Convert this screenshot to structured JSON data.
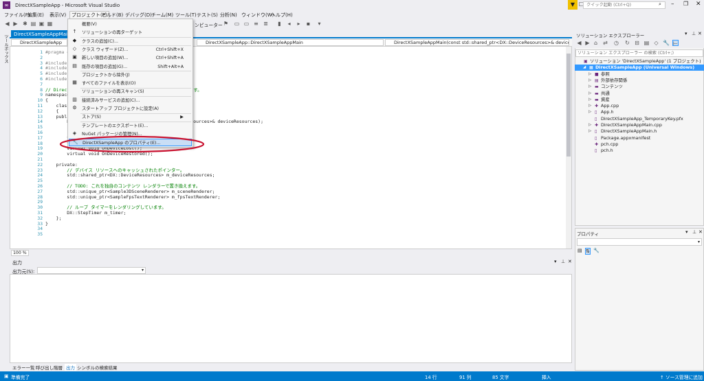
{
  "window": {
    "title": "DirectXSampleApp - Microsoft Visual Studio",
    "quick_launch": "クイック起動 (Ctrl+Q)"
  },
  "menus": [
    "ファイル(F)",
    "編集(E)",
    "表示(V)",
    "プロジェクト(P)",
    "ビルド(B)",
    "デバッグ(D)",
    "チーム(M)",
    "ツール(T)",
    "テスト(S)",
    "分析(N)",
    "ウィンドウ(W)",
    "ヘルプ(H)"
  ],
  "toolbar": {
    "debugger_label": "ンピューター"
  },
  "left_side_tab": "ツールボックス",
  "editor": {
    "tab_name": "DirectXSampleAppMain.h",
    "nav": [
      "DirectXSampleApp",
      "DirectXSampleApp::DirectXSampleAppMain",
      "DirectXSampleAppMain(const std::shared_ptr<DX::DeviceResources>& deviceResources)"
    ],
    "zoom": "100 %",
    "lines": [
      {
        "n": "1",
        "t": "#pragma o"
      },
      {
        "n": "2",
        "t": ""
      },
      {
        "n": "3",
        "t": "#include"
      },
      {
        "n": "4",
        "t": "#include"
      },
      {
        "n": "5",
        "t": "#include"
      },
      {
        "n": "6",
        "t": "#include"
      },
      {
        "n": "7",
        "t": ""
      },
      {
        "n": "8",
        "t": "// Direct                                              す。"
      },
      {
        "n": "9",
        "t": "namespace"
      },
      {
        "n": "10",
        "t": "{"
      },
      {
        "n": "11",
        "t": "    class"
      },
      {
        "n": "12",
        "t": "    {"
      },
      {
        "n": "13",
        "t": "    publi"
      },
      {
        "n": "14",
        "t": "        D                                        iceResources>& deviceResources);"
      },
      {
        "n": "15",
        "t": ""
      },
      {
        "n": "16",
        "t": ""
      },
      {
        "n": "17",
        "t": "        v"
      },
      {
        "n": "18",
        "t": "        v"
      },
      {
        "n": "19",
        "t": "        virtual void OnDeviceLost();"
      },
      {
        "n": "20",
        "t": "        virtual void OnDeviceRestored();"
      },
      {
        "n": "21",
        "t": ""
      },
      {
        "n": "22",
        "t": "    private:"
      },
      {
        "n": "23",
        "t": "        // デバイス リソースへのキャッシュされたポインター。"
      },
      {
        "n": "24",
        "t": "        std::shared_ptr<DX::DeviceResources> m_deviceResources;"
      },
      {
        "n": "25",
        "t": ""
      },
      {
        "n": "26",
        "t": "        // TODO: これを独自のコンテンツ レンダラーで置き換えます。"
      },
      {
        "n": "27",
        "t": "        std::unique_ptr<Sample3DSceneRenderer> m_sceneRenderer;"
      },
      {
        "n": "28",
        "t": "        std::unique_ptr<SampleFpsTextRenderer> m_fpsTextRenderer;"
      },
      {
        "n": "29",
        "t": ""
      },
      {
        "n": "30",
        "t": "        // ループ タイマーをレンダリングしています。"
      },
      {
        "n": "31",
        "t": "        DX::StepTimer m_timer;"
      },
      {
        "n": "32",
        "t": "    };"
      },
      {
        "n": "33",
        "t": "}"
      },
      {
        "n": "34",
        "t": ""
      },
      {
        "n": "35",
        "t": ""
      }
    ]
  },
  "dropdown": {
    "items": [
      {
        "label": "概要(V)",
        "shortcut": "",
        "icon": ""
      },
      {
        "label": "ソリューションの再ターゲット",
        "shortcut": "",
        "icon": "↑"
      },
      {
        "label": "クラスの追加(C)...",
        "shortcut": "",
        "icon": "◆"
      },
      {
        "label": "クラス ウィザード(Z)...",
        "shortcut": "Ctrl+Shift+X",
        "icon": "◇"
      },
      {
        "label": "新しい項目の追加(W)...",
        "shortcut": "Ctrl+Shift+A",
        "icon": "▣"
      },
      {
        "label": "既存の項目の追加(G)...",
        "shortcut": "Shift+Alt+A",
        "icon": "▤"
      },
      {
        "label": "プロジェクトから除外(J)",
        "shortcut": "",
        "icon": ""
      },
      {
        "label": "すべてのファイルを表示(O)",
        "shortcut": "",
        "icon": "▦"
      },
      {
        "label": "ソリューションの再スキャン(S)",
        "shortcut": "",
        "icon": ""
      },
      {
        "label": "接続済みサービスの追加(C)...",
        "shortcut": "",
        "icon": "▥"
      },
      {
        "label": "スタートアップ プロジェクトに設定(A)",
        "shortcut": "",
        "icon": "⚙"
      },
      {
        "label": "ストア(S)",
        "shortcut": "▶",
        "icon": ""
      },
      {
        "label": "テンプレートのエクスポート(E)...",
        "shortcut": "",
        "icon": ""
      },
      {
        "label": "NuGet パッケージの管理(N)...",
        "shortcut": "",
        "icon": "◈"
      },
      {
        "label": "DirectXSampleApp のプロパティ(E)...",
        "shortcut": "",
        "icon": "🔧"
      }
    ]
  },
  "output_panel": {
    "title": "出力",
    "source_label": "出力元(S):"
  },
  "bottom_tabs": [
    "エラー一覧",
    "呼び出し階層",
    "出力",
    "シンボルの検索結果"
  ],
  "solution_explorer": {
    "title": "ソリューション エクスプローラー",
    "search": "ソリューション エクスプローラー の検索 (Ctrl+;)",
    "tree": [
      {
        "label": "ソリューション 'DirectXSampleApp' (1 プロジェクト)",
        "level": 0,
        "icon": "▣",
        "arrow": ""
      },
      {
        "label": "DirectXSampleApp (Universal Windows)",
        "level": 1,
        "icon": "▦",
        "arrow": "◢",
        "selected": true
      },
      {
        "label": "参照",
        "level": 2,
        "icon": "■",
        "arrow": "▷"
      },
      {
        "label": "外部依存関係",
        "level": 2,
        "icon": "▤",
        "arrow": "▷"
      },
      {
        "label": "コンテンツ",
        "level": 2,
        "icon": "▬",
        "arrow": "▷"
      },
      {
        "label": "共通",
        "level": 2,
        "icon": "▬",
        "arrow": "▷"
      },
      {
        "label": "資産",
        "level": 2,
        "icon": "▬",
        "arrow": "▷"
      },
      {
        "label": "App.cpp",
        "level": 2,
        "icon": "✚",
        "arrow": "▷"
      },
      {
        "label": "App.h",
        "level": 2,
        "icon": "▯",
        "arrow": "▷"
      },
      {
        "label": "DirectXSampleApp_TemporaryKey.pfx",
        "level": 2,
        "icon": "▯",
        "arrow": ""
      },
      {
        "label": "DirectXSampleAppMain.cpp",
        "level": 2,
        "icon": "✚",
        "arrow": "▷"
      },
      {
        "label": "DirectXSampleAppMain.h",
        "level": 2,
        "icon": "▯",
        "arrow": "▷"
      },
      {
        "label": "Package.appxmanifest",
        "level": 2,
        "icon": "▯",
        "arrow": ""
      },
      {
        "label": "pch.cpp",
        "level": 2,
        "icon": "✚",
        "arrow": ""
      },
      {
        "label": "pch.h",
        "level": 2,
        "icon": "▯",
        "arrow": ""
      }
    ]
  },
  "properties_panel": {
    "title": "プロパティ"
  },
  "status": {
    "ready": "準備完了",
    "line": "14 行",
    "col": "91 列",
    "ch": "85 文字",
    "ins": "挿入",
    "scm": "↑ ソース管理に追加 ▲"
  },
  "colors": {
    "accent": "#007acc",
    "highlight_ring": "#c8102e"
  }
}
